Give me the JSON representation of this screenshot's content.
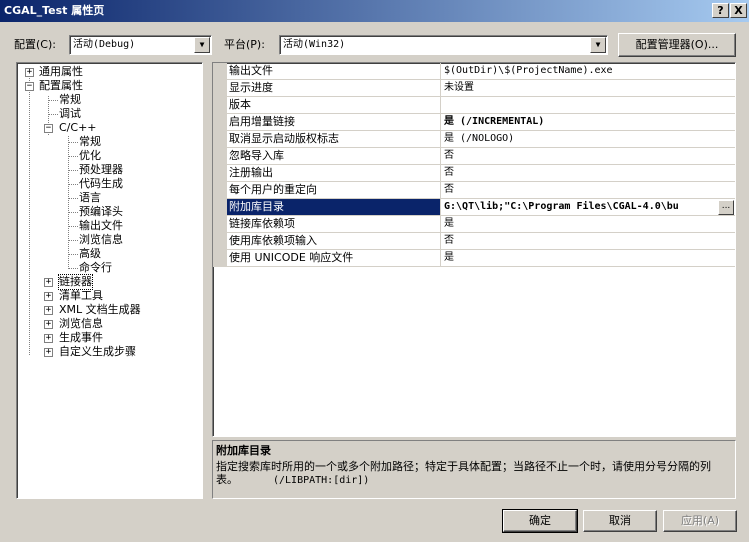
{
  "window": {
    "title": "CGAL_Test 属性页",
    "help_label": "?",
    "close_label": "X"
  },
  "header": {
    "config_label": "配置(C):",
    "config_value": "活动(Debug)",
    "platform_label": "平台(P):",
    "platform_value": "活动(Win32)",
    "config_manager_label": "配置管理器(O)..."
  },
  "tree": {
    "general": "通用属性",
    "config_props": "配置属性",
    "normal": "常规",
    "debug": "调试",
    "cpp": "C/C++",
    "cpp_children": [
      "常规",
      "优化",
      "预处理器",
      "代码生成",
      "语言",
      "预编译头",
      "输出文件",
      "浏览信息",
      "高级",
      "命令行"
    ],
    "linker": "链接器",
    "manifest": "清单工具",
    "xml_doc": "XML 文档生成器",
    "browse": "浏览信息",
    "build_events": "生成事件",
    "custom_build": "自定义生成步骤"
  },
  "properties": [
    {
      "name": "输出文件",
      "value": "$(OutDir)\\$(ProjectName).exe",
      "bold": false
    },
    {
      "name": "显示进度",
      "value": "未设置",
      "bold": false
    },
    {
      "name": "版本",
      "value": "",
      "bold": false
    },
    {
      "name": "启用增量链接",
      "value": "是 (/INCREMENTAL)",
      "bold": true
    },
    {
      "name": "取消显示启动版权标志",
      "value": "是 (/NOLOGO)",
      "bold": false
    },
    {
      "name": "忽略导入库",
      "value": "否",
      "bold": false
    },
    {
      "name": "注册输出",
      "value": "否",
      "bold": false
    },
    {
      "name": "每个用户的重定向",
      "value": "否",
      "bold": false
    },
    {
      "name": "附加库目录",
      "value": "G:\\QT\\lib;\"C:\\Program Files\\CGAL-4.0\\bu",
      "bold": true
    },
    {
      "name": "链接库依赖项",
      "value": "是",
      "bold": false
    },
    {
      "name": "使用库依赖项输入",
      "value": "否",
      "bold": false
    },
    {
      "name": "使用 UNICODE 响应文件",
      "value": "是",
      "bold": false
    }
  ],
  "ellipsis_label": "...",
  "description": {
    "title": "附加库目录",
    "text": "指定搜索库时所用的一个或多个附加路径；特定于具体配置；当路径不止一个时，请使用分号分隔的列表。",
    "switch": "(/LIBPATH:[dir])"
  },
  "footer": {
    "ok_label": "确定",
    "cancel_label": "取消",
    "apply_label": "应用(A)"
  }
}
